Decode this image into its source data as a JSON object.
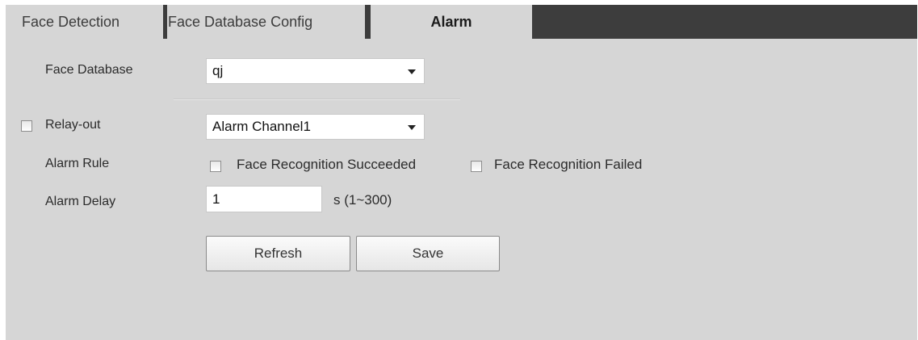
{
  "tabs": [
    {
      "label": "Face Detection",
      "active": false
    },
    {
      "label": "Face Database Config",
      "active": false
    },
    {
      "label": "Alarm",
      "active": true
    }
  ],
  "form": {
    "face_database": {
      "label": "Face Database",
      "value": "qj"
    },
    "relay_out": {
      "label": "Relay-out",
      "checked": false,
      "value": "Alarm Channel1"
    },
    "alarm_rule": {
      "label": "Alarm Rule",
      "options": [
        {
          "label": "Face Recognition Succeeded",
          "checked": false
        },
        {
          "label": "Face Recognition Failed",
          "checked": false
        }
      ]
    },
    "alarm_delay": {
      "label": "Alarm Delay",
      "value": "1",
      "unit": "s (1~300)"
    }
  },
  "buttons": {
    "refresh": "Refresh",
    "save": "Save"
  },
  "colors": {
    "panel_bg": "#d6d6d6",
    "tabbar_bg": "#3d3d3d"
  }
}
